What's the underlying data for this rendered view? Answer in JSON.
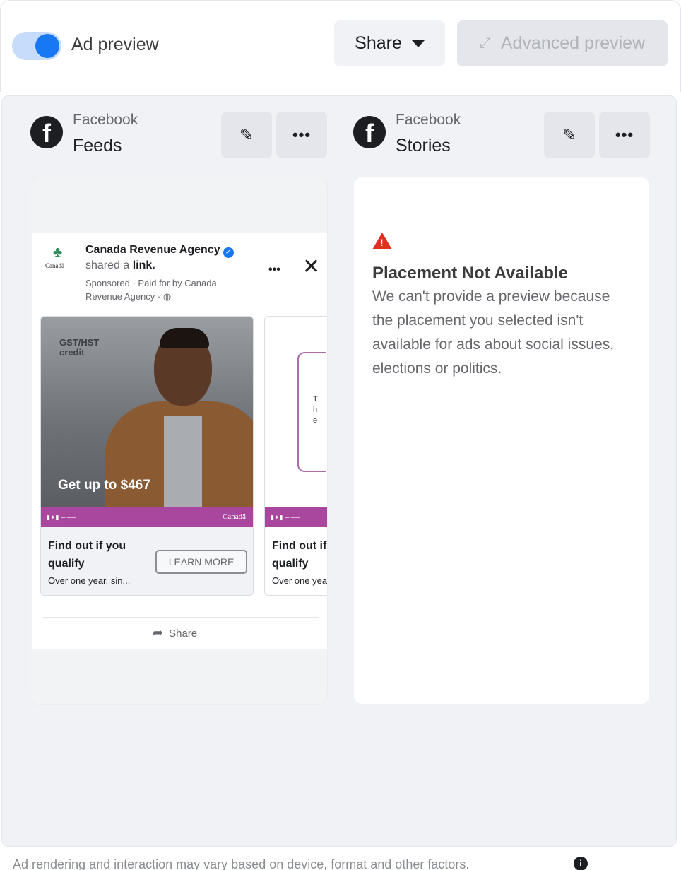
{
  "toolbar": {
    "toggle_label": "Ad preview",
    "toggle_on": true,
    "share_label": "Share",
    "advanced_label": "Advanced preview"
  },
  "placements": [
    {
      "platform": "Facebook",
      "name": "Feeds"
    },
    {
      "platform": "Facebook",
      "name": "Stories"
    }
  ],
  "feed_post": {
    "advertiser": "Canada Revenue Agency",
    "shared_prefix": "shared a",
    "shared_link": "link.",
    "sponsored_line": "Sponsored · Paid for by Canada Revenue Agency · ",
    "logo_text": "Canadä",
    "share_label": "Share",
    "cards": [
      {
        "image_badge": "GST/HST credit",
        "image_caption": "Get up to $467",
        "strip_brand": "Canadä",
        "title": "Find out if you qualify",
        "description": "Over one year, sin...",
        "cta": "LEARN MORE"
      },
      {
        "title": "Find out if you qualify",
        "description": "Over one year, sin..."
      }
    ]
  },
  "stories": {
    "warning_title": "Placement Not Available",
    "warning_body": "We can't provide a preview because the placement you selected isn't available for ads about social issues, elections or politics."
  },
  "footer": {
    "note": "Ad rendering and interaction may vary based on device, format and other factors."
  },
  "colors": {
    "accent": "#1877f2",
    "brand_strip": "#a9479f",
    "warning": "#e0301e"
  }
}
